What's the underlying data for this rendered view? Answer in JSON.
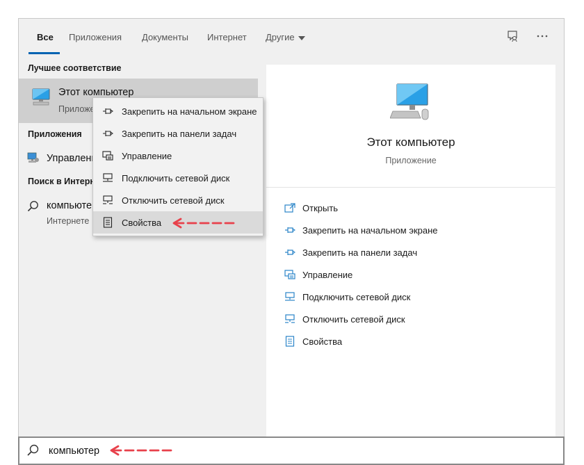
{
  "tabs": {
    "all": "Все",
    "apps": "Приложения",
    "documents": "Документы",
    "internet": "Интернет",
    "other": "Другие"
  },
  "left": {
    "best_match_title": "Лучшее соответствие",
    "best_match": {
      "name": "Этот компьютер",
      "type": "Приложение"
    },
    "apps_title": "Приложения",
    "apps_item": "Управление компьютером",
    "web_title": "Поиск в Интернете",
    "web_item": "компьютер",
    "web_item_sub": "Интернете"
  },
  "context_menu": [
    {
      "label": "Закрепить на начальном экране",
      "icon": "pin-icon"
    },
    {
      "label": "Закрепить на панели задач",
      "icon": "pin-taskbar-icon"
    },
    {
      "label": "Управление",
      "icon": "manage-icon"
    },
    {
      "label": "Подключить сетевой диск",
      "icon": "map-drive-icon"
    },
    {
      "label": "Отключить сетевой диск",
      "icon": "disconnect-drive-icon"
    },
    {
      "label": "Свойства",
      "icon": "properties-icon"
    }
  ],
  "preview": {
    "title": "Этот компьютер",
    "subtitle": "Приложение",
    "actions": [
      {
        "label": "Открыть",
        "icon": "open-icon"
      },
      {
        "label": "Закрепить на начальном экране",
        "icon": "pin-icon"
      },
      {
        "label": "Закрепить на панели задач",
        "icon": "pin-taskbar-icon"
      },
      {
        "label": "Управление",
        "icon": "manage-icon"
      },
      {
        "label": "Подключить сетевой диск",
        "icon": "map-drive-icon"
      },
      {
        "label": "Отключить сетевой диск",
        "icon": "disconnect-drive-icon"
      },
      {
        "label": "Свойства",
        "icon": "properties-icon"
      }
    ]
  },
  "search": {
    "value": "компьютер"
  },
  "colors": {
    "accent": "#0063b1",
    "annotation_arrow": "#e8414b",
    "icon_blue": "#2a84c8"
  }
}
